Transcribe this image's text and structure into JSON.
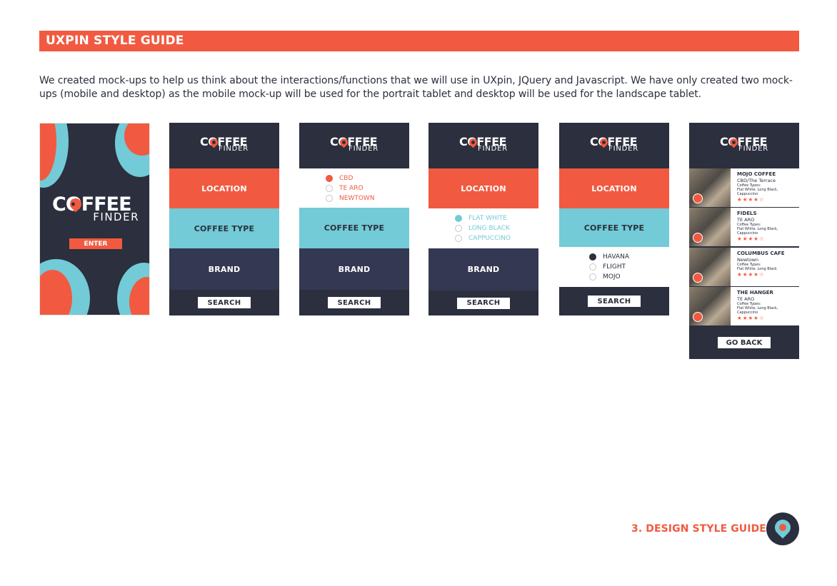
{
  "title": "UXPIN STYLE GUIDE",
  "intro": "We created mock-ups to help us think about the interactions/functions that we will use in UXpin, JQuery and Javascript. We have only created two mock-ups (mobile and desktop) as the mobile mock-up will be used for the portrait tablet and desktop will be used for the landscape tablet.",
  "colors": {
    "accent": "#f15a40",
    "navy": "#2b2f3e",
    "teal": "#72cbd6",
    "brand_block": "#343852"
  },
  "logo": {
    "line1": "COFFEE",
    "line2": "FINDER"
  },
  "splash": {
    "enter": "ENTER"
  },
  "screen": {
    "location": "LOCATION",
    "coffee_type": "COFFEE TYPE",
    "brand": "BRAND",
    "search": "SEARCH"
  },
  "locations": [
    "CBD",
    "TE ARO",
    "NEWTOWN"
  ],
  "coffee_types": [
    "FLAT WHITE",
    "LONG BLACK",
    "CAPPUCCINO"
  ],
  "brands": [
    "HAVANA",
    "FLIGHT",
    "MOJO"
  ],
  "results": [
    {
      "name": "MOJO COFFEE",
      "location": "CBD/The Terrace",
      "types_label": "Coffee Types:",
      "types": "Flat White, Long Black,",
      "types2": "Cappuccino",
      "stars": "★★★★☆"
    },
    {
      "name": "FIDELS",
      "location": "TE ARO",
      "types_label": "Coffee Types:",
      "types": "Flat White, Long Black,",
      "types2": "Cappuccino",
      "stars": "★★★★☆"
    },
    {
      "name": "COLUMBUS CAFE",
      "location": "Newtown",
      "types_label": "Coffee Types:",
      "types": "Flat White, Long Black",
      "types2": "",
      "stars": "★★★★☆"
    },
    {
      "name": "THE HANGER",
      "location": "TE ARO",
      "types_label": "Coffee Types:",
      "types": "Flat White, Long Black,",
      "types2": "Cappuccino",
      "stars": "★★★★☆"
    }
  ],
  "go_back": "GO BACK",
  "footer": "3. DESIGN STYLE GUIDE"
}
